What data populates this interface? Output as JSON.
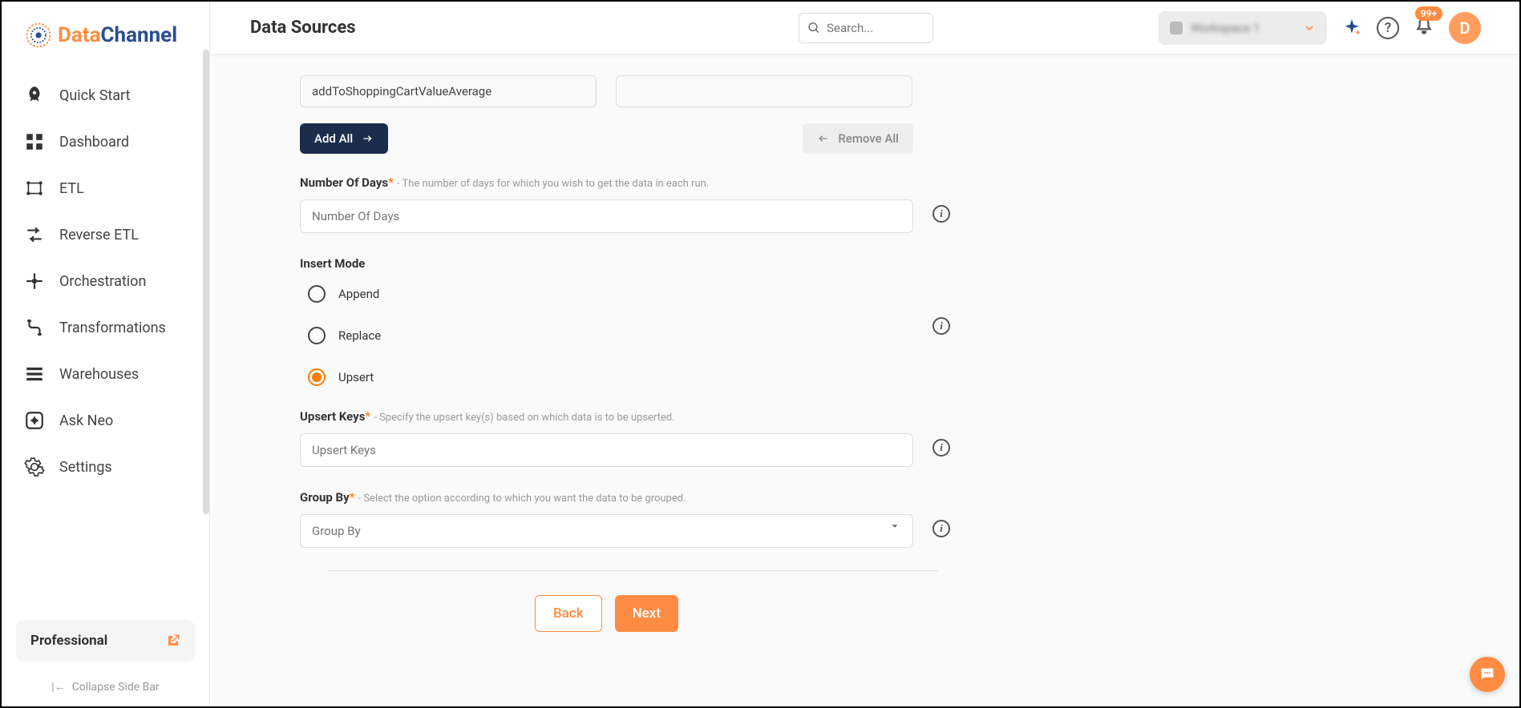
{
  "logo": {
    "text1": "Data",
    "text2": "Channel"
  },
  "sidebar": {
    "items": [
      {
        "label": "Quick Start"
      },
      {
        "label": "Dashboard"
      },
      {
        "label": "ETL"
      },
      {
        "label": "Reverse ETL"
      },
      {
        "label": "Orchestration"
      },
      {
        "label": "Transformations"
      },
      {
        "label": "Warehouses"
      },
      {
        "label": "Ask Neo"
      },
      {
        "label": "Settings"
      }
    ],
    "plan": "Professional",
    "collapse": "Collapse Side Bar"
  },
  "header": {
    "title": "Data Sources",
    "search_placeholder": "Search...",
    "org_name": "Workspace 1",
    "notif_count": "99+",
    "avatar_letter": "D"
  },
  "form": {
    "tag_value": "addToShoppingCartValueAverage",
    "add_all": "Add All",
    "remove_all": "Remove All",
    "num_days": {
      "label": "Number Of Days",
      "hint": "- The number of days for which you wish to get the data in each run.",
      "placeholder": "Number Of Days"
    },
    "insert_mode": {
      "label": "Insert Mode",
      "options": [
        "Append",
        "Replace",
        "Upsert"
      ],
      "selected": "Upsert"
    },
    "upsert_keys": {
      "label": "Upsert Keys",
      "hint": "- Specify the upsert key(s) based on which data is to be upserted.",
      "placeholder": "Upsert Keys"
    },
    "group_by": {
      "label": "Group By",
      "hint": "- Select the option according to which you want the data to be grouped.",
      "placeholder": "Group By"
    },
    "back": "Back",
    "next": "Next"
  }
}
